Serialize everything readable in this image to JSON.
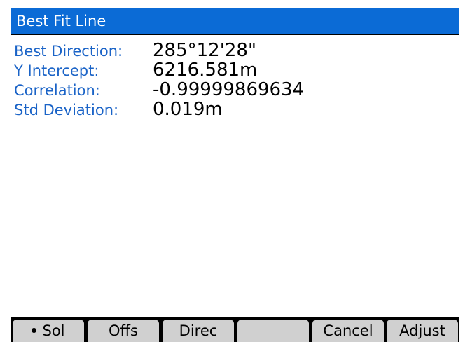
{
  "window": {
    "title": "Best Fit Line"
  },
  "results": [
    {
      "label": "Best Direction:",
      "value": "285°12'28\""
    },
    {
      "label": "Y Intercept:",
      "value": "6216.581m"
    },
    {
      "label": "Correlation:",
      "value": "-0.99999869634"
    },
    {
      "label": "Std Deviation:",
      "value": "0.019m"
    }
  ],
  "softkeys": [
    {
      "label": "Sol",
      "selected": true
    },
    {
      "label": "Offs"
    },
    {
      "label": "Direc"
    },
    {
      "label": ""
    },
    {
      "label": "Cancel"
    },
    {
      "label": "Adjust"
    }
  ],
  "colors": {
    "titlebar": "#0b6bd6",
    "label": "#1a63c7",
    "softkey": "#d0d0d0"
  }
}
